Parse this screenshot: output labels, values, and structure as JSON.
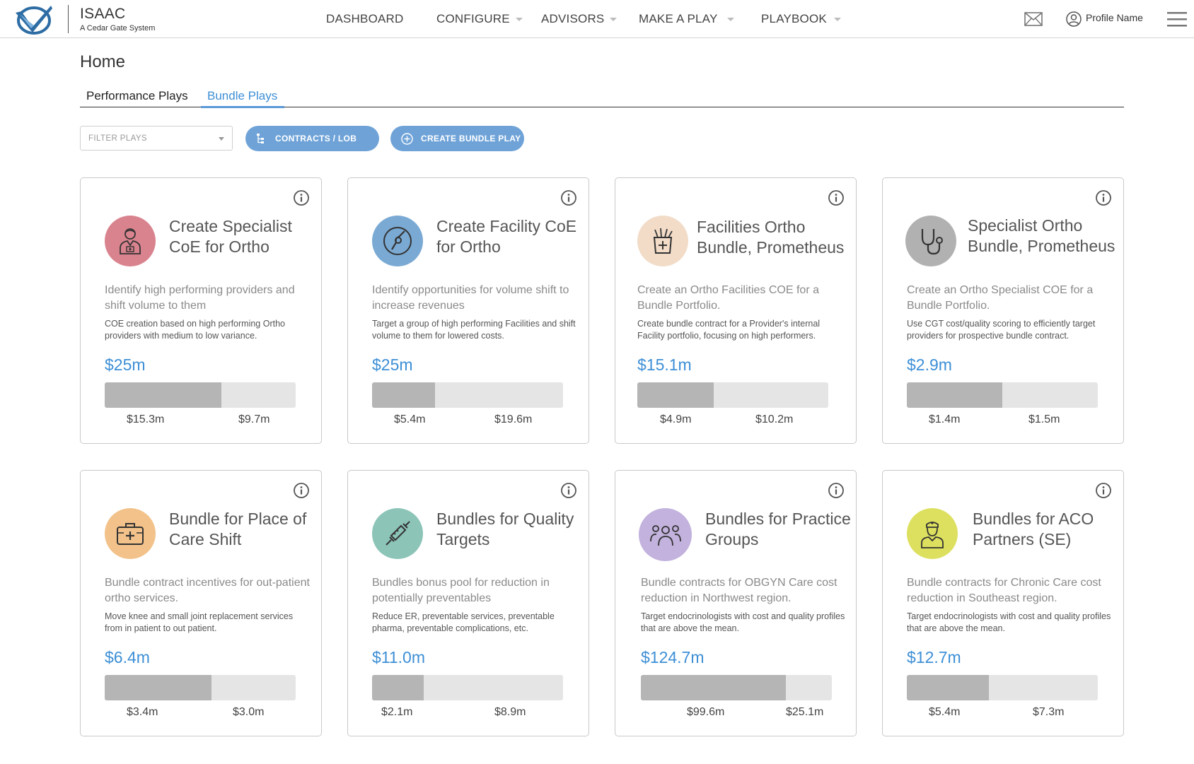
{
  "header": {
    "brand_name": "ISAAC",
    "brand_sub": "A Cedar Gate System",
    "nav": [
      {
        "label": "DASHBOARD",
        "caret": false
      },
      {
        "label": "CONFIGURE",
        "caret": true
      },
      {
        "label": "ADVISORS",
        "caret": true
      },
      {
        "label": "MAKE A PLAY",
        "caret": true
      },
      {
        "label": "PLAYBOOK",
        "caret": true
      }
    ],
    "profile_name": "Profile Name",
    "icons": [
      "logo-check-icon",
      "mail-icon",
      "user-icon",
      "hamburger-menu-icon"
    ]
  },
  "page": {
    "title": "Home",
    "tabs": [
      {
        "label": "Performance Plays",
        "active": false
      },
      {
        "label": "Bundle Plays",
        "active": true
      }
    ]
  },
  "toolbar": {
    "filter_placeholder": "FILTER PLAYS",
    "contracts_label": "CONTRACTS / LOB",
    "create_label": "CREATE BUNDLE PLAY"
  },
  "colors": {
    "accent": "#3d8fd6",
    "button": "#6fa3d8",
    "bar_fill": "#b5b5b5",
    "bar_track": "#e5e5e5"
  },
  "cards": [
    {
      "title": "Create Specialist CoE for  Ortho",
      "summary": "Identify high performing providers and shift volume to them",
      "detail": "COE creation based on high performing Ortho providers with medium to low variance.",
      "total": "$25m",
      "left_value": "$15.3m",
      "right_value": "$9.7m",
      "fraction": 0.61,
      "icon": "doctor-icon",
      "icon_color": "#d9838e"
    },
    {
      "title": "Create Facility CoE for Ortho",
      "summary": "Identify opportunities for volume shift to increase revenues",
      "detail": "Target a group of high performing Facilities and shift volume to them for lowered costs.",
      "total": "$25m",
      "left_value": "$5.4m",
      "right_value": "$19.6m",
      "fraction": 0.33,
      "icon": "bone-joint-icon",
      "icon_color": "#7aaad4"
    },
    {
      "title": "Facilities Ortho Bundle, Prometheus",
      "summary": "Create an Ortho Facilities COE for a Bundle Portfolio.",
      "detail": "Create bundle contract for a Provider's internal Facility portfolio, focusing on high performers.",
      "total": "$15.1m",
      "left_value": "$4.9m",
      "right_value": "$10.2m",
      "fraction": 0.4,
      "icon": "medicine-cup-icon",
      "icon_color": "#f2dcc8"
    },
    {
      "title": "Specialist Ortho Bundle, Prometheus",
      "summary": "Create an Ortho Specialist COE for a Bundle Portfolio.",
      "detail": "Use CGT cost/quality scoring to efficiently target providers for prospective bundle contract.",
      "total": "$2.9m",
      "left_value": "$1.4m",
      "right_value": "$1.5m",
      "fraction": 0.5,
      "icon": "stethoscope-icon",
      "icon_color": "#b1b1b1"
    },
    {
      "title": "Bundle for Place of Care Shift",
      "summary": "Bundle contract incentives for out-patient ortho services.",
      "detail": "Move knee and small joint replacement services from in patient to out patient.",
      "total": "$6.4m",
      "left_value": "$3.4m",
      "right_value": "$3.0m",
      "fraction": 0.56,
      "icon": "medical-kit-icon",
      "icon_color": "#f2c28a"
    },
    {
      "title": "Bundles for Quality Targets",
      "summary": "Bundles bonus pool for reduction in potentially preventables",
      "detail": "Reduce ER, preventable services, preventable pharma, preventable complications, etc.",
      "total": "$11.0m",
      "left_value": "$2.1m",
      "right_value": "$8.9m",
      "fraction": 0.27,
      "icon": "syringe-icon",
      "icon_color": "#8cc4b8"
    },
    {
      "title": "Bundles for Practice Groups",
      "summary": "Bundle contracts for OBGYN Care cost reduction in Northwest region.",
      "detail": "Target endocrinologists with cost and quality profiles that are above the mean.",
      "total": "$124.7m",
      "left_value": "$99.6m",
      "right_value": "$25.1m",
      "fraction": 0.76,
      "icon": "group-icon",
      "icon_color": "#c2b2dd"
    },
    {
      "title": "Bundles for ACO Partners (SE)",
      "summary": "Bundle contracts for Chronic Care cost reduction in Southeast region.",
      "detail": "Target endocrinologists with cost and quality profiles that are above the mean.",
      "total": "$12.7m",
      "left_value": "$5.4m",
      "right_value": "$7.3m",
      "fraction": 0.43,
      "icon": "nurse-icon",
      "icon_color": "#dde05e"
    }
  ]
}
